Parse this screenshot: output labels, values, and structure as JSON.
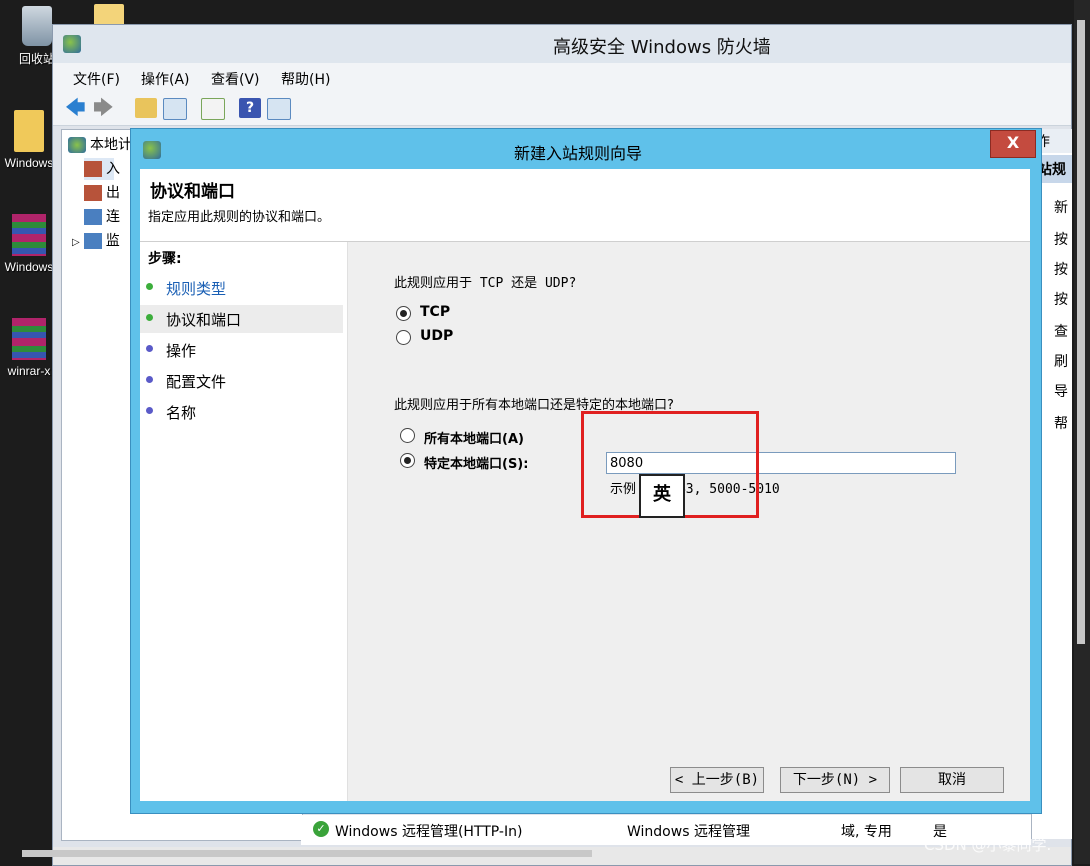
{
  "desktop": {
    "icons": [
      {
        "label": "回收站"
      },
      {
        "label": "Windows"
      },
      {
        "label": "Windows"
      },
      {
        "label": "winrar-x"
      }
    ]
  },
  "mmc": {
    "title": "高级安全 Windows 防火墙",
    "menu": [
      "文件(F)",
      "操作(A)",
      "查看(V)",
      "帮助(H)"
    ],
    "tree": [
      {
        "label": "本地计"
      },
      {
        "label": "入"
      },
      {
        "label": "出"
      },
      {
        "label": "连"
      },
      {
        "label": "监"
      }
    ],
    "actions": {
      "header": "作",
      "subheader": "站规",
      "items": [
        "新",
        "按",
        "按",
        "按",
        "查",
        "刷",
        "导",
        "帮"
      ]
    },
    "bottom_row": {
      "name": "Windows 远程管理(HTTP-In)",
      "group": "Windows 远程管理",
      "profile": "域, 专用",
      "enabled": "是"
    }
  },
  "wizard": {
    "title": "新建入站规则向导",
    "close_label": "X",
    "heading": "协议和端口",
    "subheading": "指定应用此规则的协议和端口。",
    "steps_title": "步骤:",
    "steps": [
      {
        "label": "规则类型",
        "state": "done"
      },
      {
        "label": "协议和端口",
        "state": "current"
      },
      {
        "label": "操作",
        "state": "pending"
      },
      {
        "label": "配置文件",
        "state": "pending"
      },
      {
        "label": "名称",
        "state": "pending"
      }
    ],
    "protocol_question": "此规则应用于 TCP 还是 UDP?",
    "protocol_options": [
      "TCP",
      "UDP"
    ],
    "protocol_selected": "TCP",
    "port_question": "此规则应用于所有本地端口还是特定的本地端口?",
    "port_options": [
      "所有本地端口(A)",
      "特定本地端口(S):"
    ],
    "port_selected": "特定本地端口(S):",
    "port_value": "8080",
    "example_prefix": "示例",
    "example_suffix": "443, 5000-5010",
    "ime_indicator": "英",
    "buttons": {
      "back": "< 上一步(B)",
      "next": "下一步(N) >",
      "cancel": "取消"
    }
  },
  "watermark": "CSDN @小黎同学.",
  "colors": {
    "wizard_frame": "#5fc1ea",
    "close_button": "#c44b3f",
    "highlight_box": "#e02020",
    "step_done": "#3cae3c",
    "step_pending": "#5a5ac8",
    "step_link": "#1a5fb4"
  }
}
